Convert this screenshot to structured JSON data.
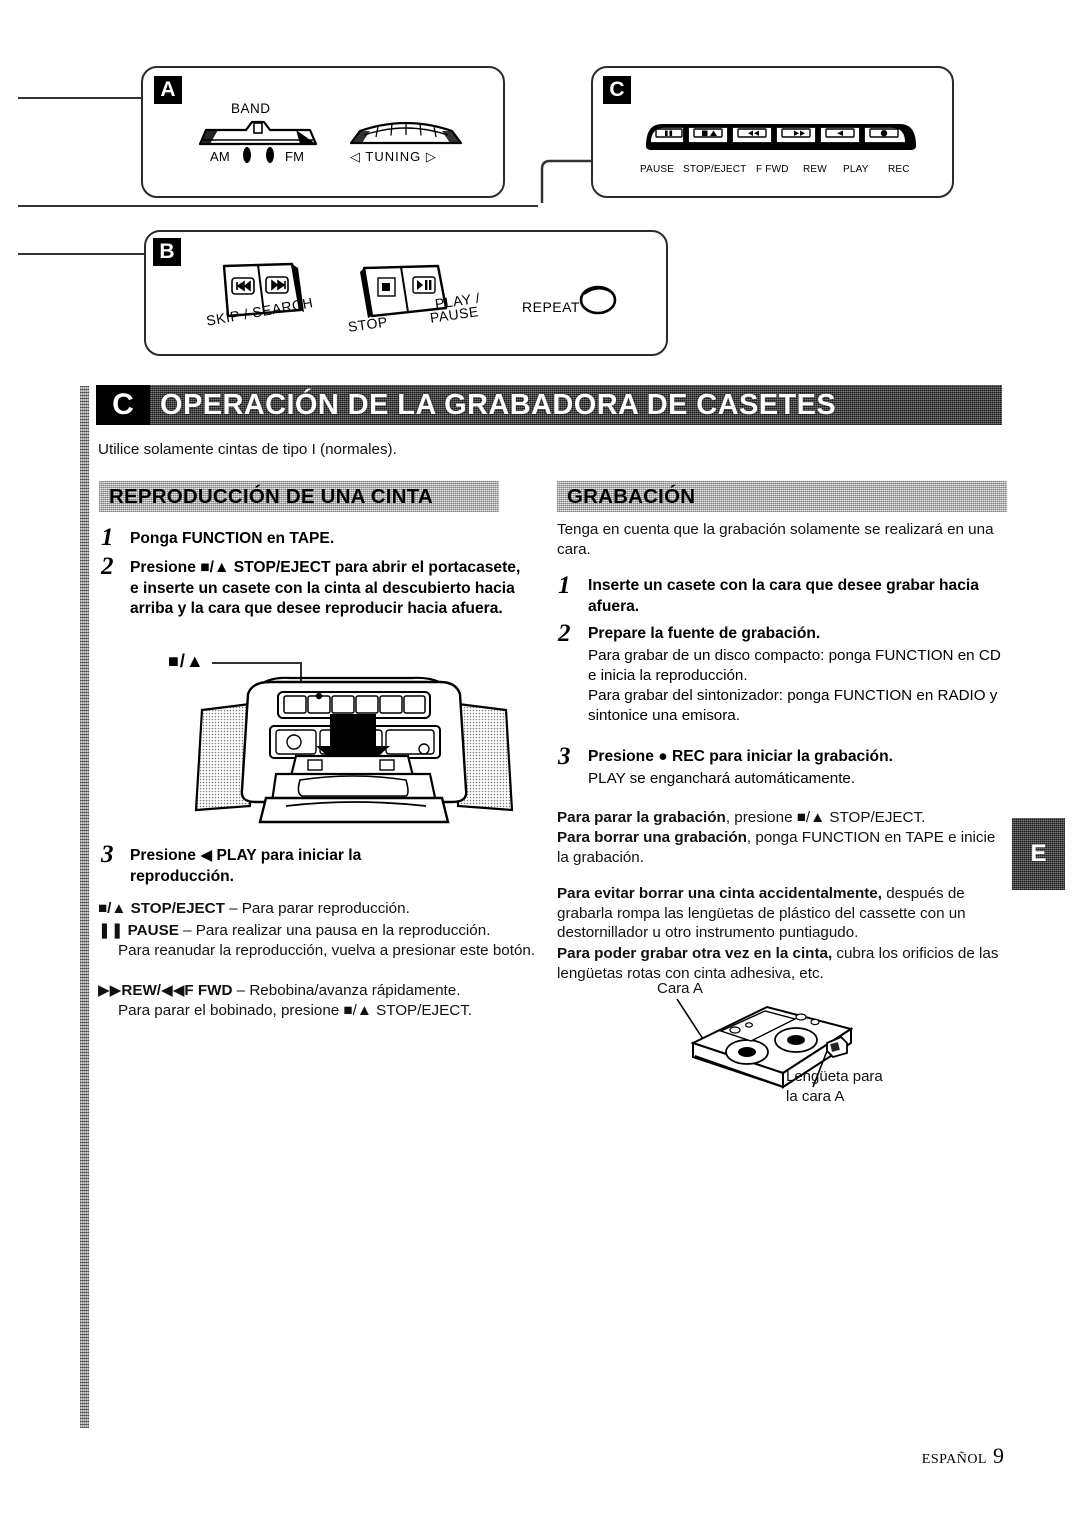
{
  "page": {
    "footer_label": "ESPAÑOL",
    "footer_page_number": "9",
    "side_tab_letter": "E"
  },
  "diagrams": {
    "panel_a": {
      "badge": "A",
      "band_label": "BAND",
      "band_positions": "AM ▮ ▮ FM",
      "am_label": "AM",
      "fm_label": "FM",
      "tuning_label": "◁ TUNING ▷"
    },
    "panel_b": {
      "badge": "B",
      "skip_search_label": "SKIP / SEARCH",
      "stop_label": "STOP",
      "play_pause_label": "PLAY /\nPAUSE",
      "play_pause_line1": "PLAY /",
      "play_pause_line2": "PAUSE",
      "repeat_label": "REPEAT",
      "skip_back_icon": "⏮",
      "skip_fwd_icon": "⏭",
      "stop_icon": "■",
      "play_pause_icon": "▶⏸"
    },
    "panel_c": {
      "badge": "C",
      "buttons": [
        {
          "label": "PAUSE",
          "icon": "❚❚"
        },
        {
          "label": "STOP/EJECT",
          "icon": "■/▲"
        },
        {
          "label": "F FWD",
          "icon": "◀◀"
        },
        {
          "label": "REW",
          "icon": "▶▶"
        },
        {
          "label": "PLAY",
          "icon": "◀"
        },
        {
          "label": "REC",
          "icon": "●"
        }
      ]
    }
  },
  "section": {
    "badge": "C",
    "title": "OPERACIÓN DE LA GRABADORA DE CASETES",
    "intro": "Utilice solamente cintas de tipo I (normales)."
  },
  "playback": {
    "heading": "REPRODUCCIÓN DE UNA CINTA",
    "steps": [
      {
        "num": "1",
        "text": "Ponga FUNCTION en TAPE."
      },
      {
        "num": "2",
        "text": "Presione ■/▲ STOP/EJECT para abrir el portacasete, e inserte un casete con la cinta al descubierto hacia arriba y la cara que desee reproducir hacia afuera."
      },
      {
        "num": "3",
        "text": "Presione ◀ PLAY para iniciar la reproducción."
      }
    ],
    "deck_callout": "■/▲",
    "notes": [
      {
        "lead": "■/▲ STOP/EJECT",
        "rest": " – Para parar reproducción."
      },
      {
        "lead": "❚❚ PAUSE",
        "rest": " – Para realizar una pausa en la reproducción."
      },
      {
        "lead": "",
        "rest": "Para reanudar la reproducción, vuelva a presionar este botón."
      },
      {
        "lead": "▶▶REW/◀◀F FWD",
        "rest": " – Rebobina/avanza rápidamente."
      },
      {
        "lead": "",
        "rest": "Para parar el bobinado, presione ■/▲ STOP/EJECT."
      }
    ]
  },
  "recording": {
    "heading": "GRABACIÓN",
    "intro": "Tenga en cuenta que la grabación solamente se realizará en una cara.",
    "steps": [
      {
        "num": "1",
        "text": "Inserte un casete con la cara que desee grabar hacia afuera.",
        "sub": ""
      },
      {
        "num": "2",
        "text": "Prepare la fuente de grabación.",
        "sub": "Para grabar de un disco compacto: ponga FUNCTION en CD e inicia la reproducción.\nPara grabar del sintonizador: ponga FUNCTION en RADIO y sintonice una emisora."
      },
      {
        "num": "3",
        "text": "Presione ● REC para iniciar la grabación.",
        "sub": "PLAY se enganchará automáticamente."
      }
    ],
    "note_stop_lead": "Para parar la grabación",
    "note_stop_rest": ", presione ■/▲ STOP/EJECT.",
    "note_erase_lead": "Para borrar una grabación",
    "note_erase_rest": ", ponga FUNCTION en TAPE e inicie la grabación.",
    "note_protect_lead": "Para evitar borrar una cinta accidentalmente,",
    "note_protect_rest": " después de grabarla rompa las lengüetas de plástico del cassette con un destornillador u otro instrumento puntiagudo.",
    "note_reuse_lead": "Para poder grabar otra vez en la cinta,",
    "note_reuse_rest": " cubra los orificios de las lengüetas rotas con cinta adhesiva, etc.",
    "cassette_side_a_label": "Cara A",
    "cassette_tab_label_line1": "Lengüeta para",
    "cassette_tab_label_line2": "la cara A"
  }
}
